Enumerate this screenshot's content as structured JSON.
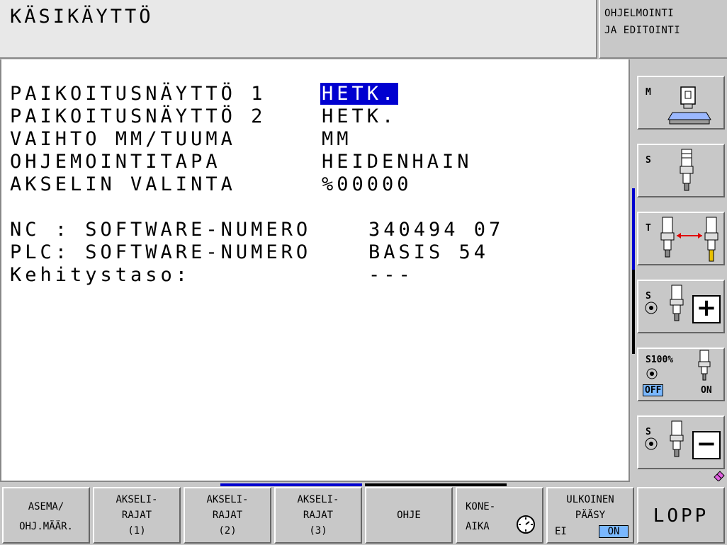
{
  "header": {
    "mode_title": "KÄSIKÄYTTÖ",
    "program_mode_line1": "OHJELMOINTI",
    "program_mode_line2": "JA EDITOINTI"
  },
  "main": {
    "settings": [
      {
        "label": "PAIKOITUSNÄYTTÖ 1",
        "value": "HETK.",
        "selected": true
      },
      {
        "label": "PAIKOITUSNÄYTTÖ 2",
        "value": "HETK."
      },
      {
        "label": "VAIHTO MM/TUUMA",
        "value": "MM"
      },
      {
        "label": "OHJEMOINTITAPA",
        "value": "HEIDENHAIN"
      },
      {
        "label": "AKSELIN VALINTA",
        "value": "%00000"
      }
    ],
    "info": [
      {
        "label": "NC : SOFTWARE-NUMERO",
        "value": "340494 07"
      },
      {
        "label": "PLC: SOFTWARE-NUMERO",
        "value": "BASIS 54"
      },
      {
        "label": "Kehitystaso:",
        "value": "---"
      }
    ]
  },
  "side_softkeys": {
    "m_label": "M",
    "s_label": "S",
    "t_label": "T",
    "s_plus_label": "S",
    "s100_label": "S100%",
    "s100_off": "OFF",
    "s100_on": "ON",
    "s_minus_label": "S"
  },
  "bottom_softkeys": {
    "asema_l1": "ASEMA/",
    "asema_l2": "OHJ.MÄÄR.",
    "ak1_l1": "AKSELI-",
    "ak1_l2": "RAJAT",
    "ak1_l3": "(1)",
    "ak2_l1": "AKSELI-",
    "ak2_l2": "RAJAT",
    "ak2_l3": "(2)",
    "ak3_l1": "AKSELI-",
    "ak3_l2": "RAJAT",
    "ak3_l3": "(3)",
    "ohje": "OHJE",
    "kone_l1": "KONE-",
    "kone_l2": "AIKA",
    "ulk_l1": "ULKOINEN",
    "ulk_l2": "PÄÄSY",
    "ulk_ei": "EI",
    "ulk_on": "ON",
    "lopp": "LOPP"
  },
  "colors": {
    "selection": "#0000d0",
    "toggle_active": "#7ab8ff",
    "screen_bg": "#ffffff",
    "panel_bg": "#c8c8c8",
    "arrow": "#e00000"
  }
}
